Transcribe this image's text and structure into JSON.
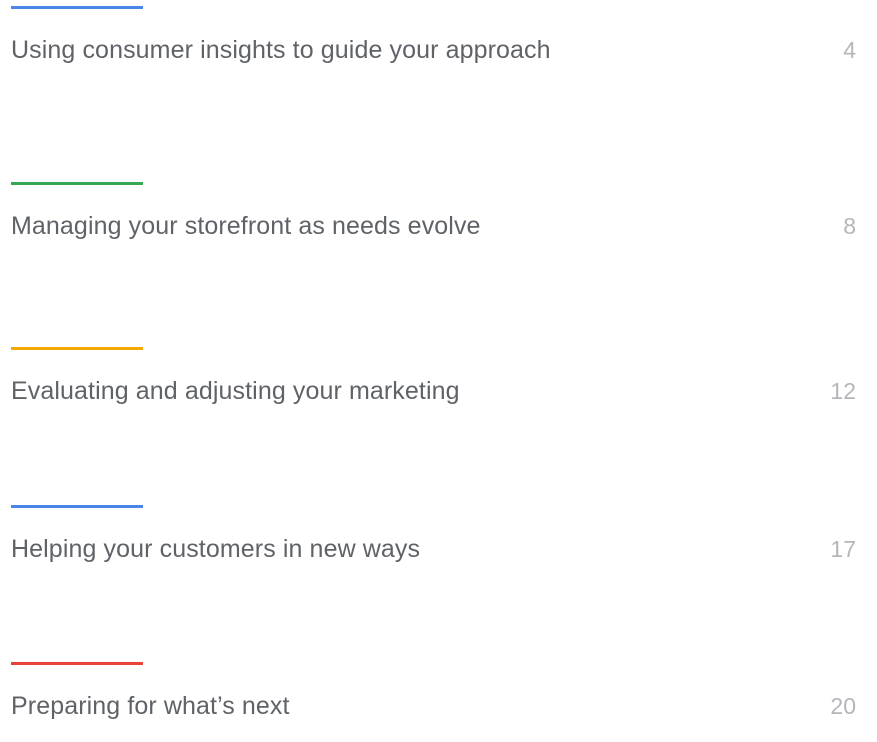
{
  "toc": {
    "entries": [
      {
        "title": "Using consumer insights to guide your approach",
        "page": "4",
        "accent": "#4a86e8"
      },
      {
        "title": "Managing your storefront as needs evolve",
        "page": "8",
        "accent": "#34a853"
      },
      {
        "title": "Evaluating and adjusting your marketing",
        "page": "12",
        "accent": "#f2a900"
      },
      {
        "title": "Helping your customers in new ways",
        "page": "17",
        "accent": "#4a86e8"
      },
      {
        "title": "Preparing for what’s next",
        "page": "20",
        "accent": "#ea4335"
      }
    ]
  }
}
